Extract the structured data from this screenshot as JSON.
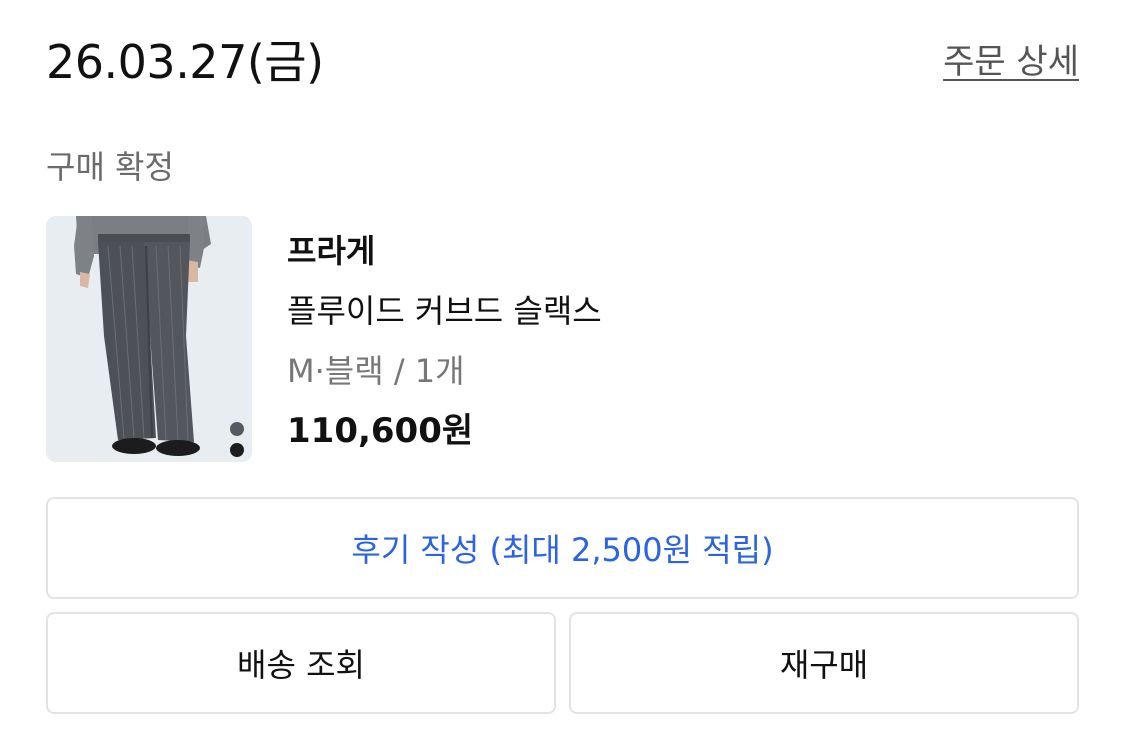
{
  "order": {
    "date": "26.03.27(금)",
    "detail_link": "주문 상세",
    "status": "구매 확정"
  },
  "product": {
    "brand": "프라게",
    "name": "플루이드 커브드 슬랙스",
    "option": "M·블랙 / 1개",
    "price": "110,600원",
    "color_swatches": [
      "#555b61",
      "#1e1e1e"
    ]
  },
  "actions": {
    "review": "후기 작성 (최대 2,500원 적립)",
    "track": "배송 조회",
    "rebuy": "재구매"
  },
  "colors": {
    "accent": "#2a63e6",
    "muted": "#777777",
    "border": "#e3e3e3"
  }
}
